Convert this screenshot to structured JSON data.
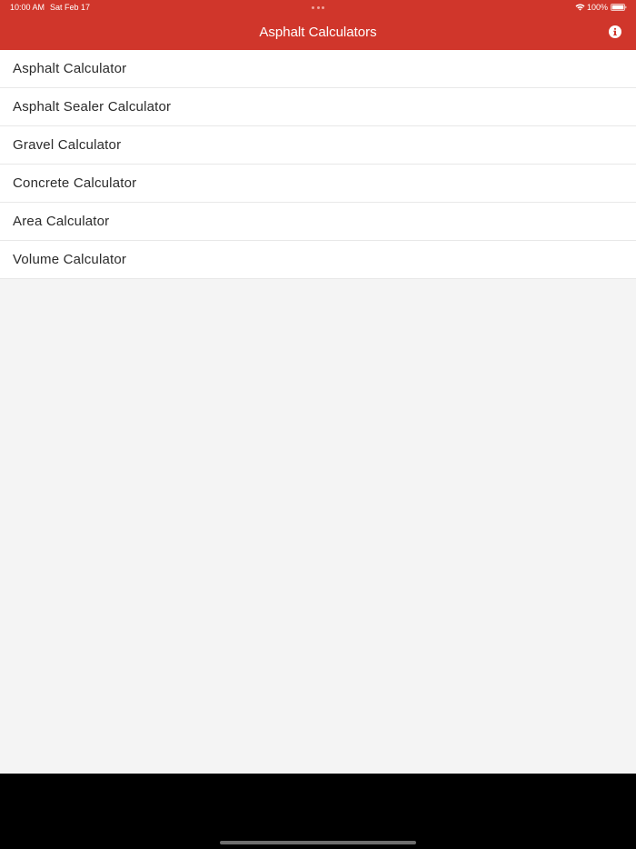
{
  "status_bar": {
    "time": "10:00 AM",
    "date": "Sat Feb 17",
    "battery": "100%"
  },
  "nav": {
    "title": "Asphalt Calculators",
    "info_icon": "info-circle-icon"
  },
  "calculators": [
    {
      "label": "Asphalt Calculator"
    },
    {
      "label": "Asphalt Sealer Calculator"
    },
    {
      "label": "Gravel Calculator"
    },
    {
      "label": "Concrete Calculator"
    },
    {
      "label": "Area Calculator"
    },
    {
      "label": "Volume Calculator"
    }
  ],
  "colors": {
    "header": "#d0362b",
    "background": "#f4f4f4",
    "list_background": "#ffffff",
    "text": "#2b2b2b"
  }
}
